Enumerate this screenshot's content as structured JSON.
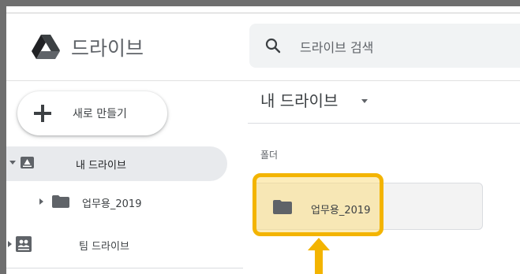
{
  "app": {
    "logo_text": "드라이브"
  },
  "search": {
    "placeholder": "드라이브 검색"
  },
  "sidebar": {
    "new_label": "새로 만들기",
    "items": [
      {
        "label": "내 드라이브"
      },
      {
        "label": "업무용_2019"
      },
      {
        "label": "팀 드라이브"
      }
    ]
  },
  "main": {
    "breadcrumb": "내 드라이브",
    "section_label": "폴더",
    "folder_name": "업무용_2019"
  },
  "colors": {
    "highlight": "#f3b400",
    "selected_nav_bg": "#e8eaed",
    "search_bg": "#f1f3f4"
  }
}
